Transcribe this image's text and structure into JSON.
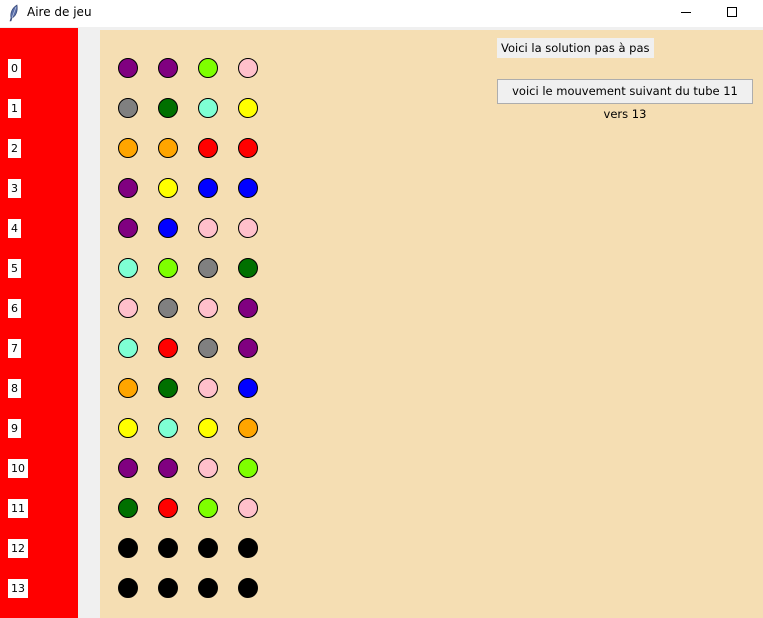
{
  "window": {
    "title": "Aire de jeu",
    "icons": {
      "app": "feather-icon",
      "minimize": "minimize-icon",
      "maximize": "maximize-icon"
    }
  },
  "colors": {
    "sidebar": "#ff0000",
    "board": "#f5deb3"
  },
  "tubes": [
    {
      "label": "0",
      "balls": [
        "#800080",
        "#800080",
        "#7fff00",
        "#ffc0cb"
      ]
    },
    {
      "label": "1",
      "balls": [
        "#808080",
        "#007000",
        "#7fffd4",
        "#ffff00"
      ]
    },
    {
      "label": "2",
      "balls": [
        "#ffa500",
        "#ffa500",
        "#ff0000",
        "#ff0000"
      ]
    },
    {
      "label": "3",
      "balls": [
        "#800080",
        "#ffff00",
        "#0000ff",
        "#0000ff"
      ]
    },
    {
      "label": "4",
      "balls": [
        "#800080",
        "#0000ff",
        "#ffc0cb",
        "#ffc0cb"
      ]
    },
    {
      "label": "5",
      "balls": [
        "#7fffd4",
        "#7fff00",
        "#808080",
        "#007000"
      ]
    },
    {
      "label": "6",
      "balls": [
        "#ffc0cb",
        "#808080",
        "#ffc0cb",
        "#800080"
      ]
    },
    {
      "label": "7",
      "balls": [
        "#7fffd4",
        "#ff0000",
        "#808080",
        "#800080"
      ]
    },
    {
      "label": "8",
      "balls": [
        "#ffa500",
        "#007000",
        "#ffc0cb",
        "#0000ff"
      ]
    },
    {
      "label": "9",
      "balls": [
        "#ffff00",
        "#7fffd4",
        "#ffff00",
        "#ffa500"
      ]
    },
    {
      "label": "10",
      "balls": [
        "#800080",
        "#800080",
        "#ffc0cb",
        "#7fff00"
      ]
    },
    {
      "label": "11",
      "balls": [
        "#007000",
        "#ff0000",
        "#7fff00",
        "#ffc0cb"
      ]
    },
    {
      "label": "12",
      "balls": [
        "#000000",
        "#000000",
        "#000000",
        "#000000"
      ]
    },
    {
      "label": "13",
      "balls": [
        "#000000",
        "#000000",
        "#000000",
        "#000000"
      ]
    }
  ],
  "panel": {
    "info_label": "Voici la solution pas à pas",
    "next_move_button": "voici le mouvement suivant du tube 11 vers 13"
  }
}
